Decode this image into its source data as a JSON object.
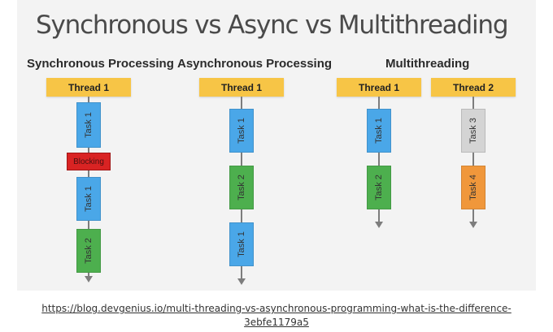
{
  "title": "Synchronous vs Async vs Multithreading",
  "columns": {
    "sync": {
      "heading": "Synchronous Processing",
      "thread": "Thread 1",
      "tasks": [
        "Task 1",
        "Task 1",
        "Task 2"
      ],
      "blocking": "Blocking"
    },
    "async": {
      "heading": "Asynchronous Processing",
      "thread": "Thread 1",
      "tasks": [
        "Task 1",
        "Task 2",
        "Task 1"
      ]
    },
    "multi": {
      "heading": "Multithreading",
      "thread1": "Thread 1",
      "thread2": "Thread 2",
      "thread1_tasks": [
        "Task 1",
        "Task 2"
      ],
      "thread2_tasks": [
        "Task 3",
        "Task 4"
      ]
    }
  },
  "colors": {
    "thread": "#f7c546",
    "task_blue": "#4aa7e8",
    "task_green": "#4daf4e",
    "task_gray": "#d4d4d4",
    "task_orange": "#f0973b",
    "blocking": "#d92323"
  },
  "source": {
    "line1": "https://blog.devgenius.io/multi-threading-vs-asynchronous-programming-what-is-the-difference-",
    "line2": "3ebfe1179a5"
  }
}
